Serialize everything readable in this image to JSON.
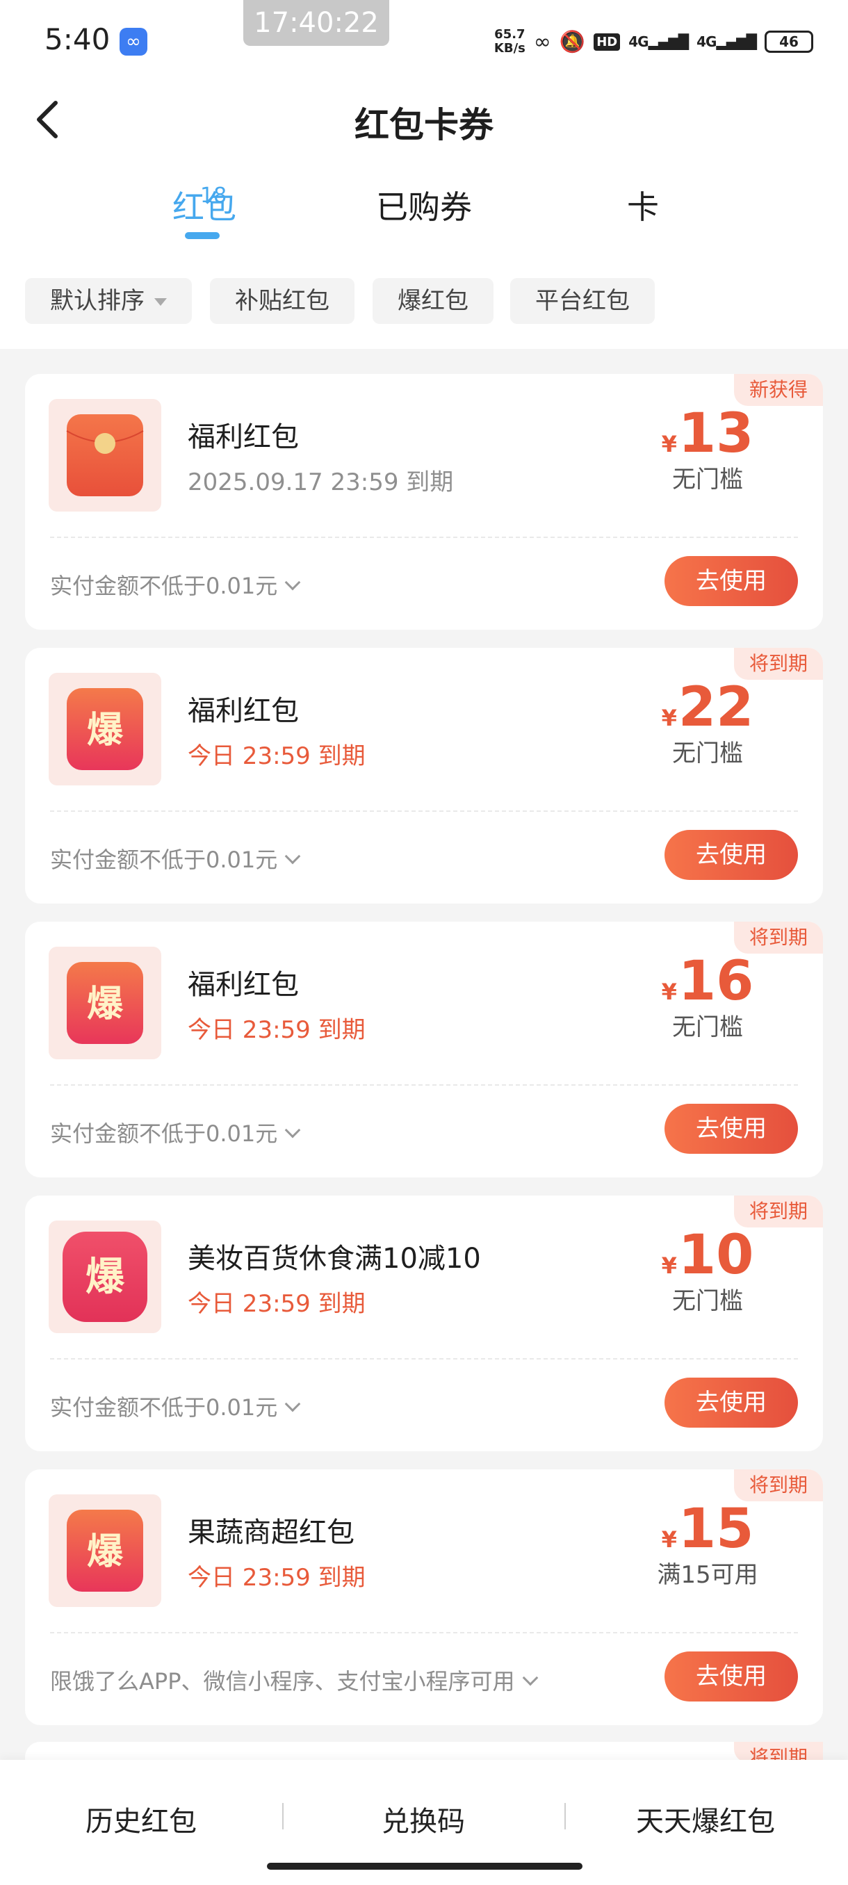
{
  "status_bar": {
    "time": "5:40",
    "overlay_time": "17:40:22",
    "net_speed_value": "65.7",
    "net_speed_unit": "KB/s",
    "hd_label": "HD",
    "signal_1": "4G",
    "signal_2": "4G",
    "battery": "46"
  },
  "header": {
    "title": "红包卡券"
  },
  "tabs": [
    {
      "label": "红包",
      "badge": "18",
      "active": true
    },
    {
      "label": "已购券"
    },
    {
      "label": "卡"
    }
  ],
  "filters": [
    {
      "label": "默认排序"
    },
    {
      "label": "补贴红包"
    },
    {
      "label": "爆红包"
    },
    {
      "label": "平台红包"
    }
  ],
  "icon_char": "爆",
  "coupons": [
    {
      "tag": "新获得",
      "icon": "red-envelope-icon",
      "title": "福利红包",
      "expiry": "2025.09.17 23:59 到期",
      "currency": "¥",
      "amount": "13",
      "condition": "无门槛",
      "rule": "实付金额不低于0.01元",
      "button": "去使用"
    },
    {
      "tag": "将到期",
      "icon": "bao-icon",
      "title": "福利红包",
      "expiry": "今日 23:59 到期",
      "currency": "¥",
      "amount": "22",
      "condition": "无门槛",
      "rule": "实付金额不低于0.01元",
      "button": "去使用"
    },
    {
      "tag": "将到期",
      "icon": "bao-icon",
      "title": "福利红包",
      "expiry": "今日 23:59 到期",
      "currency": "¥",
      "amount": "16",
      "condition": "无门槛",
      "rule": "实付金额不低于0.01元",
      "button": "去使用"
    },
    {
      "tag": "将到期",
      "icon": "bao-icon",
      "title": "美妆百货休食满10减10",
      "expiry": "今日 23:59 到期",
      "currency": "¥",
      "amount": "10",
      "condition": "无门槛",
      "rule": "实付金额不低于0.01元",
      "button": "去使用"
    },
    {
      "tag": "将到期",
      "icon": "bao-icon",
      "title": "果蔬商超红包",
      "expiry": "今日 23:59 到期",
      "currency": "¥",
      "amount": "15",
      "condition": "满15可用",
      "rule": "限饿了么APP、微信小程序、支付宝小程序可用",
      "button": "去使用"
    }
  ],
  "peek_tag": "将到期",
  "bottom_bar": {
    "items": [
      "历史红包",
      "兑换码",
      "天天爆红包"
    ]
  },
  "colors": {
    "accent_blue": "#46a8ee",
    "accent_red": "#e85a3a",
    "button_gradient_start": "#f6744a",
    "button_gradient_end": "#e5503d"
  }
}
